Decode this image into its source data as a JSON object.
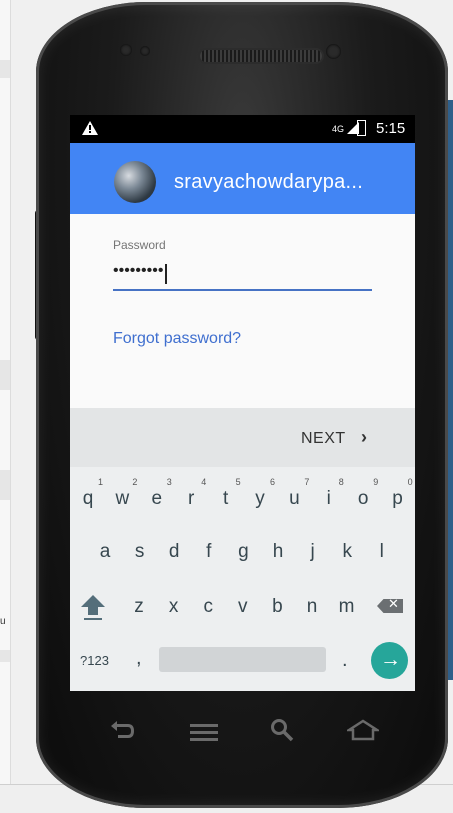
{
  "status_bar": {
    "warning_icon": "warning-icon",
    "network": "4G",
    "time": "5:15"
  },
  "app_bar": {
    "account_name": "sravyachowdarypa...",
    "avatar_icon": "avatar"
  },
  "form": {
    "password_label": "Password",
    "password_value": "•••••••••",
    "forgot_link": "Forgot password?"
  },
  "keyboard": {
    "next_label": "NEXT",
    "row1": [
      "q",
      "w",
      "e",
      "r",
      "t",
      "y",
      "u",
      "i",
      "o",
      "p"
    ],
    "row1_hints": [
      "1",
      "2",
      "3",
      "4",
      "5",
      "6",
      "7",
      "8",
      "9",
      "0"
    ],
    "row2": [
      "a",
      "s",
      "d",
      "f",
      "g",
      "h",
      "j",
      "k",
      "l"
    ],
    "row3": [
      "z",
      "x",
      "c",
      "v",
      "b",
      "n",
      "m"
    ],
    "symbols_label": "?123",
    "comma": ",",
    "period": "."
  },
  "nav_bar": {
    "back_icon": "back-icon",
    "menu_icon": "menu-icon",
    "search_icon": "search-icon",
    "home_icon": "home-icon"
  },
  "colors": {
    "app_bar": "#4285f4",
    "accent_line": "#4672c4",
    "link": "#3f6fcf",
    "go_button": "#26a69a"
  }
}
